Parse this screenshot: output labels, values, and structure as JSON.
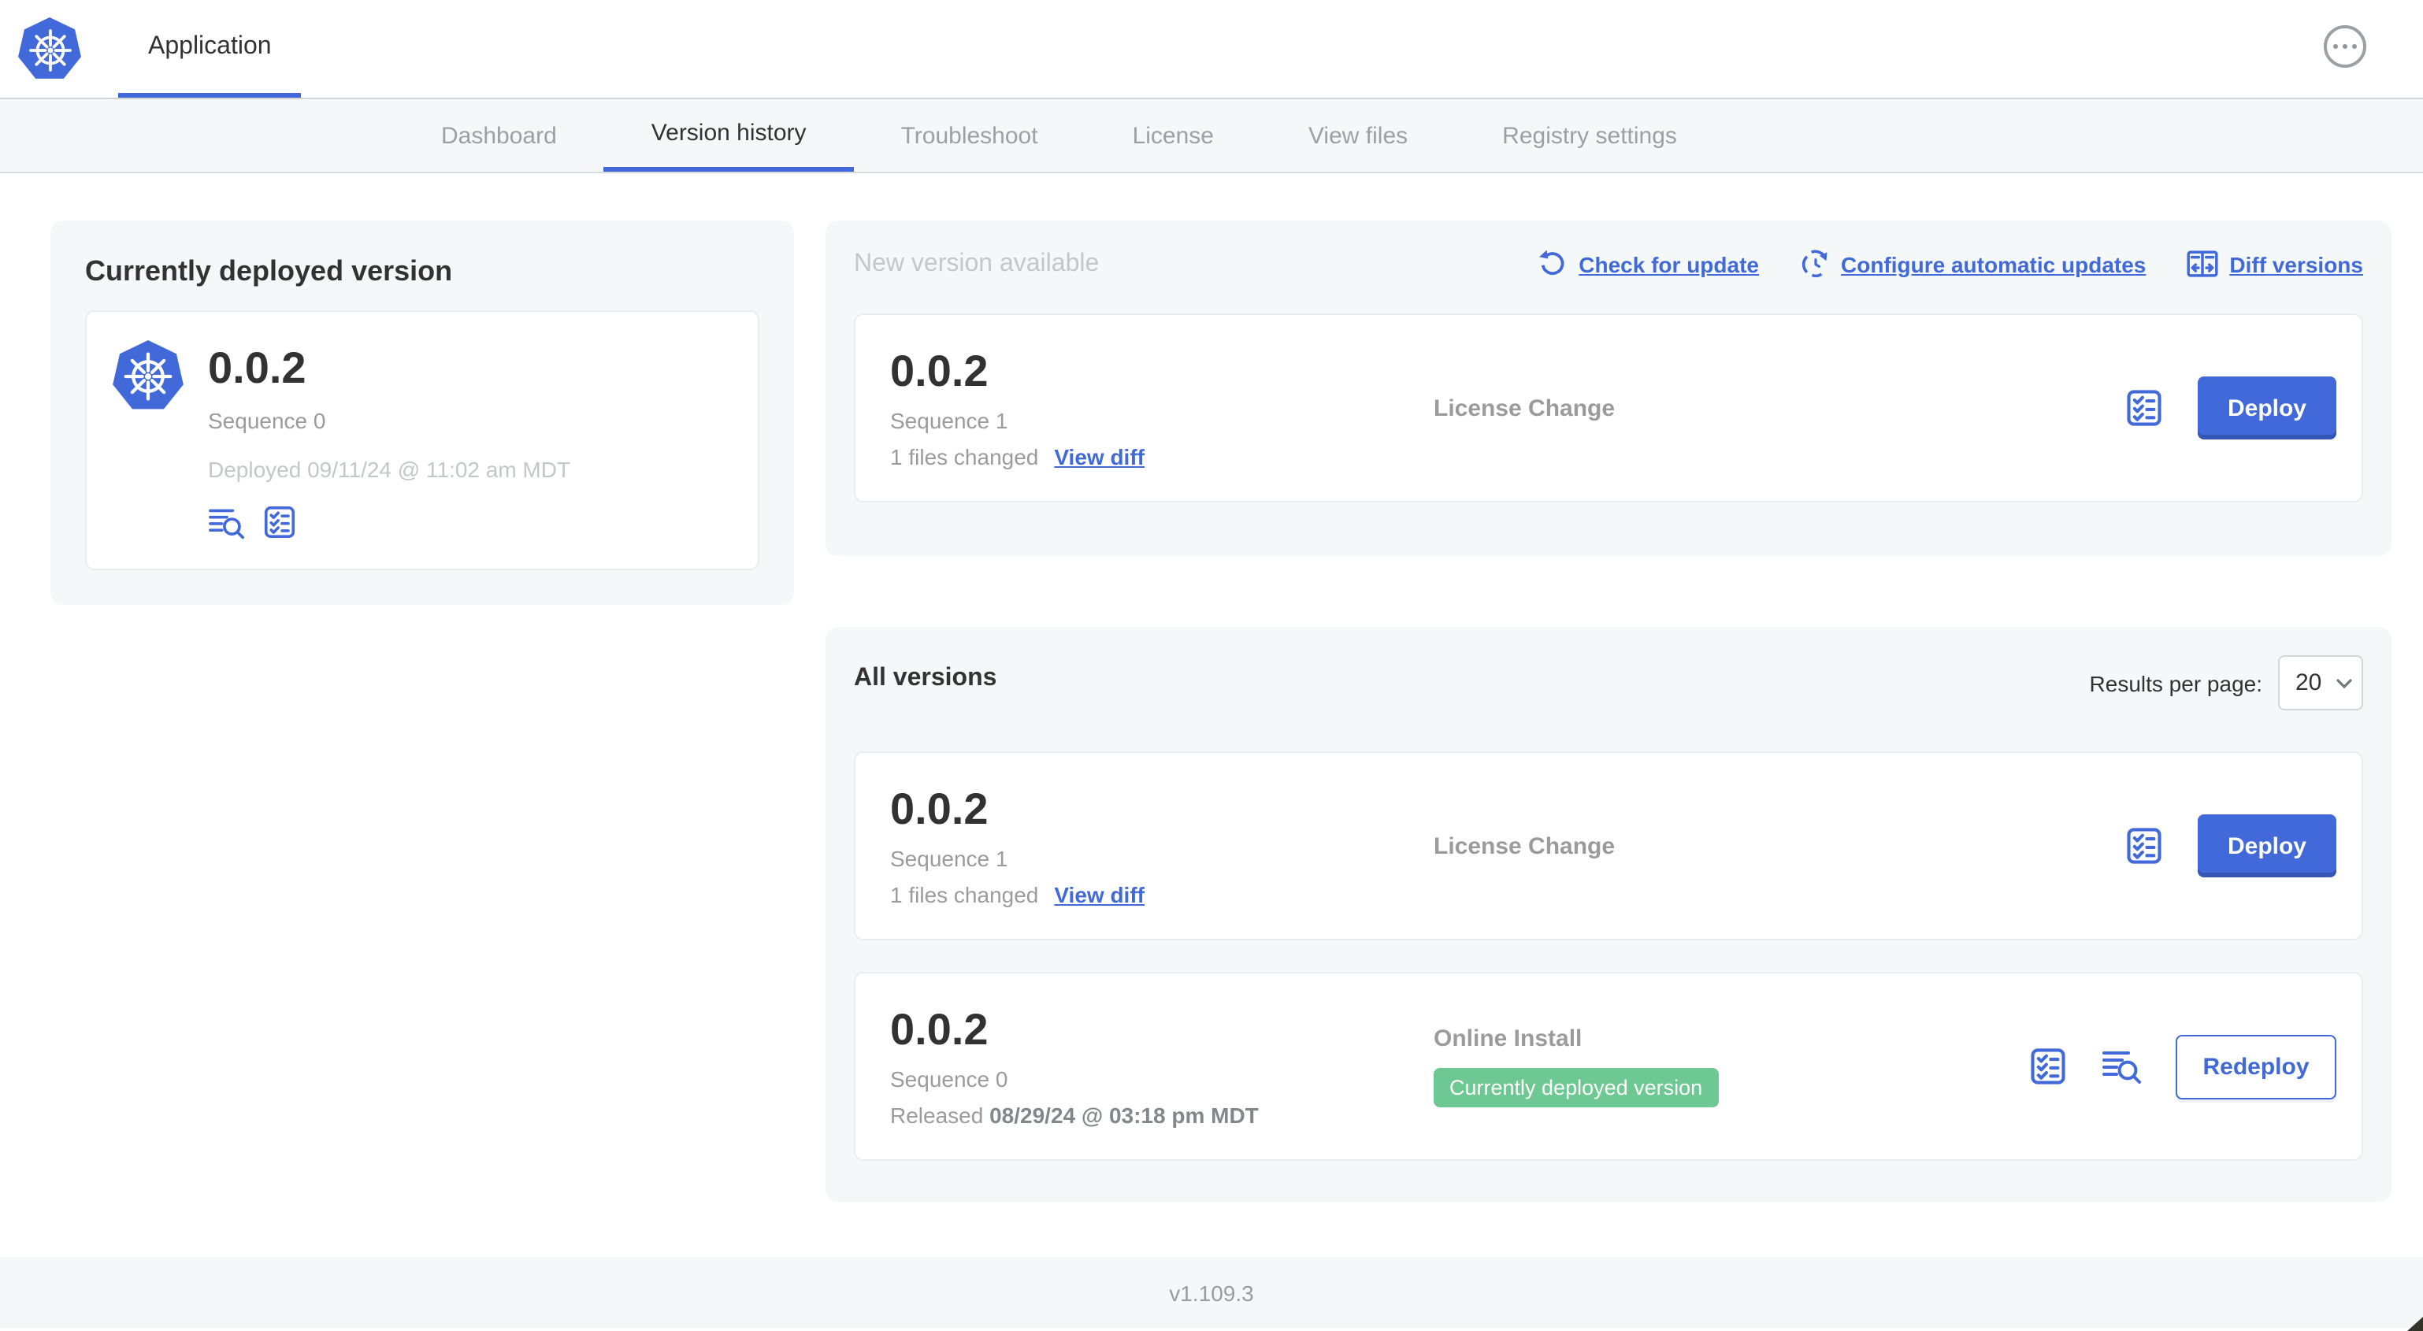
{
  "colors": {
    "accent_blue": "#4169d9",
    "badge_green": "#6ec893",
    "text_dark": "#323232",
    "text_gray": "#9b9b9b",
    "text_light": "#c3c7ca",
    "panel_bg": "#f5f8f9"
  },
  "header": {
    "app_tab_label": "Application",
    "logo_icon": "kubernetes-wheel-icon",
    "menu_icon": "ellipsis-icon"
  },
  "nav": {
    "active_tab": "Version history",
    "tabs": [
      "Dashboard",
      "Version history",
      "Troubleshoot",
      "License",
      "View files",
      "Registry settings"
    ]
  },
  "current_version_card": {
    "title": "Currently deployed version",
    "version": "0.0.2",
    "sequence_label": "Sequence 0",
    "deployed_label": "Deployed 09/11/24 @ 11:02 am MDT",
    "icons": [
      "deploy-logs-icon",
      "preflight-checklist-icon"
    ]
  },
  "new_version_panel": {
    "title": "New version available",
    "actions": [
      {
        "label": "Check for update",
        "icon": "refresh-icon"
      },
      {
        "label": "Configure automatic updates",
        "icon": "clock-refresh-icon"
      },
      {
        "label": "Diff versions",
        "icon": "diff-icon"
      }
    ],
    "card": {
      "version": "0.0.2",
      "sequence_label": "Sequence 1",
      "files_changed_label": "1 files changed",
      "view_diff_label": "View diff",
      "source": "License Change",
      "deploy_label": "Deploy",
      "icons": [
        "preflight-checklist-icon"
      ]
    }
  },
  "all_versions_panel": {
    "title": "All versions",
    "results_per_page_label": "Results per page:",
    "results_per_page_value": "20",
    "rows": [
      {
        "version": "0.0.2",
        "sequence_label": "Sequence 1",
        "files_changed_label": "1 files changed",
        "view_diff_label": "View diff",
        "source": "License Change",
        "deploy_label": "Deploy",
        "icons": [
          "preflight-checklist-icon"
        ]
      },
      {
        "version": "0.0.2",
        "sequence_label": "Sequence 0",
        "released_prefix": "Released",
        "released_date": "08/29/24 @ 03:18 pm MDT",
        "source": "Online Install",
        "badge_label": "Currently deployed version",
        "redeploy_label": "Redeploy",
        "icons": [
          "preflight-checklist-icon",
          "deploy-logs-icon"
        ]
      }
    ]
  },
  "footer": {
    "version_label": "v1.109.3"
  }
}
